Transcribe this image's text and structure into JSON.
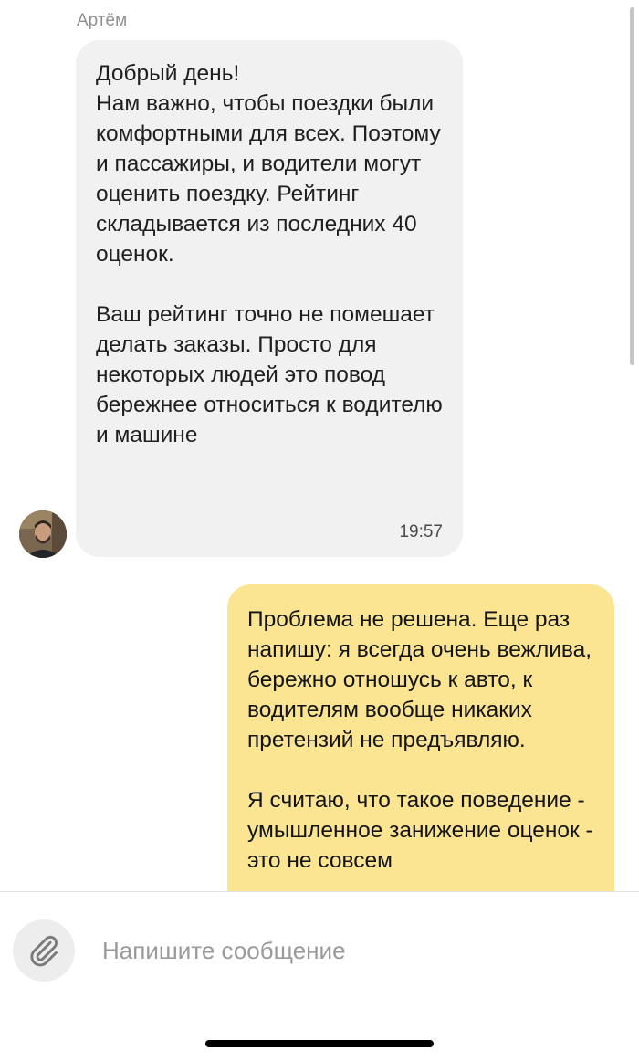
{
  "chat": {
    "sender_name": "Артём",
    "incoming_message": {
      "text": "Добрый день!\nНам важно, чтобы поездки были комфортными для всех. Поэтому и пассажиры, и водители могут оценить поездку. Рейтинг складывается из последних 40 оценок.\n\nВаш рейтинг точно не помешает делать заказы. Просто для некоторых людей это повод бережнее относиться к водителю и машине",
      "time": "19:57"
    },
    "outgoing_message": {
      "text": "Проблема не решена. Еще раз напишу: я всегда очень вежлива, бережно отношусь к авто, к водителям вообще никаких претензий не предъявляю.\n\nЯ считаю, что такое поведение - умышленное занижение оценок - это не совсем"
    }
  },
  "composer": {
    "placeholder": "Напишите сообщение",
    "value": "",
    "attach_icon": "paperclip-icon"
  },
  "colors": {
    "incoming_bubble": "#f1f1f1",
    "outgoing_bubble": "#fbe593",
    "timestamp": "#4a4a4a",
    "sender_name": "#8f8f8f",
    "placeholder": "#9a9a9a"
  }
}
